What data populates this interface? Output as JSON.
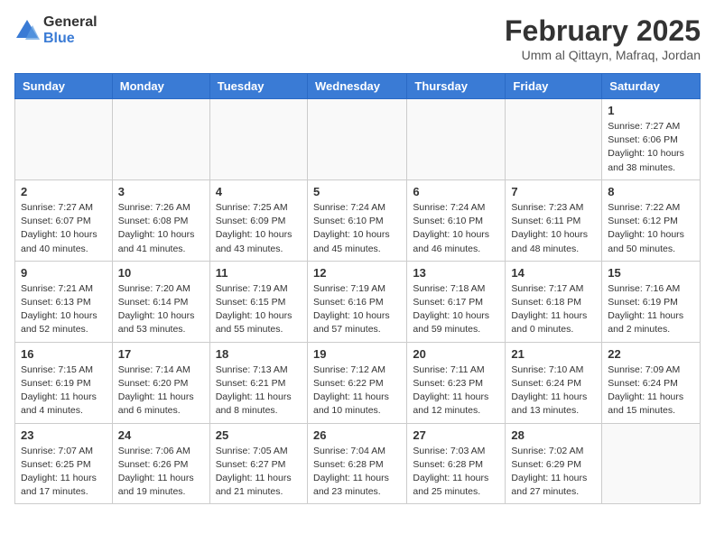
{
  "logo": {
    "text_general": "General",
    "text_blue": "Blue"
  },
  "header": {
    "month": "February 2025",
    "location": "Umm al Qittayn, Mafraq, Jordan"
  },
  "weekdays": [
    "Sunday",
    "Monday",
    "Tuesday",
    "Wednesday",
    "Thursday",
    "Friday",
    "Saturday"
  ],
  "weeks": [
    [
      {
        "day": "",
        "info": ""
      },
      {
        "day": "",
        "info": ""
      },
      {
        "day": "",
        "info": ""
      },
      {
        "day": "",
        "info": ""
      },
      {
        "day": "",
        "info": ""
      },
      {
        "day": "",
        "info": ""
      },
      {
        "day": "1",
        "info": "Sunrise: 7:27 AM\nSunset: 6:06 PM\nDaylight: 10 hours\nand 38 minutes."
      }
    ],
    [
      {
        "day": "2",
        "info": "Sunrise: 7:27 AM\nSunset: 6:07 PM\nDaylight: 10 hours\nand 40 minutes."
      },
      {
        "day": "3",
        "info": "Sunrise: 7:26 AM\nSunset: 6:08 PM\nDaylight: 10 hours\nand 41 minutes."
      },
      {
        "day": "4",
        "info": "Sunrise: 7:25 AM\nSunset: 6:09 PM\nDaylight: 10 hours\nand 43 minutes."
      },
      {
        "day": "5",
        "info": "Sunrise: 7:24 AM\nSunset: 6:10 PM\nDaylight: 10 hours\nand 45 minutes."
      },
      {
        "day": "6",
        "info": "Sunrise: 7:24 AM\nSunset: 6:10 PM\nDaylight: 10 hours\nand 46 minutes."
      },
      {
        "day": "7",
        "info": "Sunrise: 7:23 AM\nSunset: 6:11 PM\nDaylight: 10 hours\nand 48 minutes."
      },
      {
        "day": "8",
        "info": "Sunrise: 7:22 AM\nSunset: 6:12 PM\nDaylight: 10 hours\nand 50 minutes."
      }
    ],
    [
      {
        "day": "9",
        "info": "Sunrise: 7:21 AM\nSunset: 6:13 PM\nDaylight: 10 hours\nand 52 minutes."
      },
      {
        "day": "10",
        "info": "Sunrise: 7:20 AM\nSunset: 6:14 PM\nDaylight: 10 hours\nand 53 minutes."
      },
      {
        "day": "11",
        "info": "Sunrise: 7:19 AM\nSunset: 6:15 PM\nDaylight: 10 hours\nand 55 minutes."
      },
      {
        "day": "12",
        "info": "Sunrise: 7:19 AM\nSunset: 6:16 PM\nDaylight: 10 hours\nand 57 minutes."
      },
      {
        "day": "13",
        "info": "Sunrise: 7:18 AM\nSunset: 6:17 PM\nDaylight: 10 hours\nand 59 minutes."
      },
      {
        "day": "14",
        "info": "Sunrise: 7:17 AM\nSunset: 6:18 PM\nDaylight: 11 hours\nand 0 minutes."
      },
      {
        "day": "15",
        "info": "Sunrise: 7:16 AM\nSunset: 6:19 PM\nDaylight: 11 hours\nand 2 minutes."
      }
    ],
    [
      {
        "day": "16",
        "info": "Sunrise: 7:15 AM\nSunset: 6:19 PM\nDaylight: 11 hours\nand 4 minutes."
      },
      {
        "day": "17",
        "info": "Sunrise: 7:14 AM\nSunset: 6:20 PM\nDaylight: 11 hours\nand 6 minutes."
      },
      {
        "day": "18",
        "info": "Sunrise: 7:13 AM\nSunset: 6:21 PM\nDaylight: 11 hours\nand 8 minutes."
      },
      {
        "day": "19",
        "info": "Sunrise: 7:12 AM\nSunset: 6:22 PM\nDaylight: 11 hours\nand 10 minutes."
      },
      {
        "day": "20",
        "info": "Sunrise: 7:11 AM\nSunset: 6:23 PM\nDaylight: 11 hours\nand 12 minutes."
      },
      {
        "day": "21",
        "info": "Sunrise: 7:10 AM\nSunset: 6:24 PM\nDaylight: 11 hours\nand 13 minutes."
      },
      {
        "day": "22",
        "info": "Sunrise: 7:09 AM\nSunset: 6:24 PM\nDaylight: 11 hours\nand 15 minutes."
      }
    ],
    [
      {
        "day": "23",
        "info": "Sunrise: 7:07 AM\nSunset: 6:25 PM\nDaylight: 11 hours\nand 17 minutes."
      },
      {
        "day": "24",
        "info": "Sunrise: 7:06 AM\nSunset: 6:26 PM\nDaylight: 11 hours\nand 19 minutes."
      },
      {
        "day": "25",
        "info": "Sunrise: 7:05 AM\nSunset: 6:27 PM\nDaylight: 11 hours\nand 21 minutes."
      },
      {
        "day": "26",
        "info": "Sunrise: 7:04 AM\nSunset: 6:28 PM\nDaylight: 11 hours\nand 23 minutes."
      },
      {
        "day": "27",
        "info": "Sunrise: 7:03 AM\nSunset: 6:28 PM\nDaylight: 11 hours\nand 25 minutes."
      },
      {
        "day": "28",
        "info": "Sunrise: 7:02 AM\nSunset: 6:29 PM\nDaylight: 11 hours\nand 27 minutes."
      },
      {
        "day": "",
        "info": ""
      }
    ]
  ]
}
